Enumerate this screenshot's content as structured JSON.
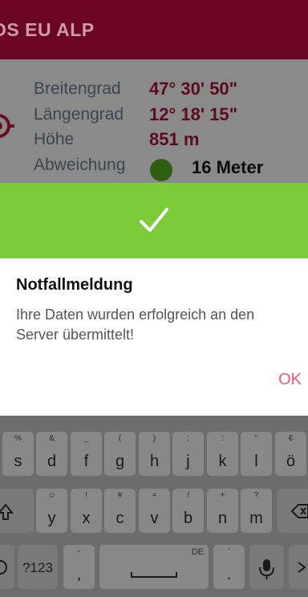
{
  "app": {
    "title": "OS EU ALP",
    "rows": [
      {
        "label": "Breitengrad",
        "value": "47° 30' 50\""
      },
      {
        "label": "Längengrad",
        "value": "12° 18' 15\""
      },
      {
        "label": "Höhe",
        "value": "851 m"
      },
      {
        "label": "Abweichung",
        "value": "16 Meter"
      }
    ]
  },
  "dialog": {
    "title": "Notfallmeldung",
    "message": "Ihre Daten wurden erfolgreich an den Server übermittelt!",
    "ok_label": "OK"
  },
  "keyboard": {
    "row1": [
      {
        "main": "s",
        "hint": "%"
      },
      {
        "main": "d",
        "hint": "&"
      },
      {
        "main": "f",
        "hint": "_"
      },
      {
        "main": "g",
        "hint": "("
      },
      {
        "main": "h",
        "hint": ")"
      },
      {
        "main": "j",
        "hint": ";"
      },
      {
        "main": "k",
        "hint": ":"
      },
      {
        "main": "l",
        "hint": "\""
      },
      {
        "main": "ö",
        "hint": "€"
      }
    ],
    "row2": [
      {
        "main": "y",
        "hint": "☺"
      },
      {
        "main": "x",
        "hint": "!"
      },
      {
        "main": "c",
        "hint": "#"
      },
      {
        "main": "v",
        "hint": "="
      },
      {
        "main": "b",
        "hint": "/"
      },
      {
        "main": "n",
        "hint": "+"
      },
      {
        "main": "m",
        "hint": "?"
      }
    ],
    "symbols_label": "?123",
    "comma_label": ",",
    "comma_hint": "-",
    "period_label": ".",
    "period_hint": "'",
    "language_label": "DE"
  },
  "colors": {
    "app_bar": "#6a0623",
    "success": "#7ecb3a",
    "ok_text": "#f0596b",
    "status_dot": "#2d5e12"
  }
}
